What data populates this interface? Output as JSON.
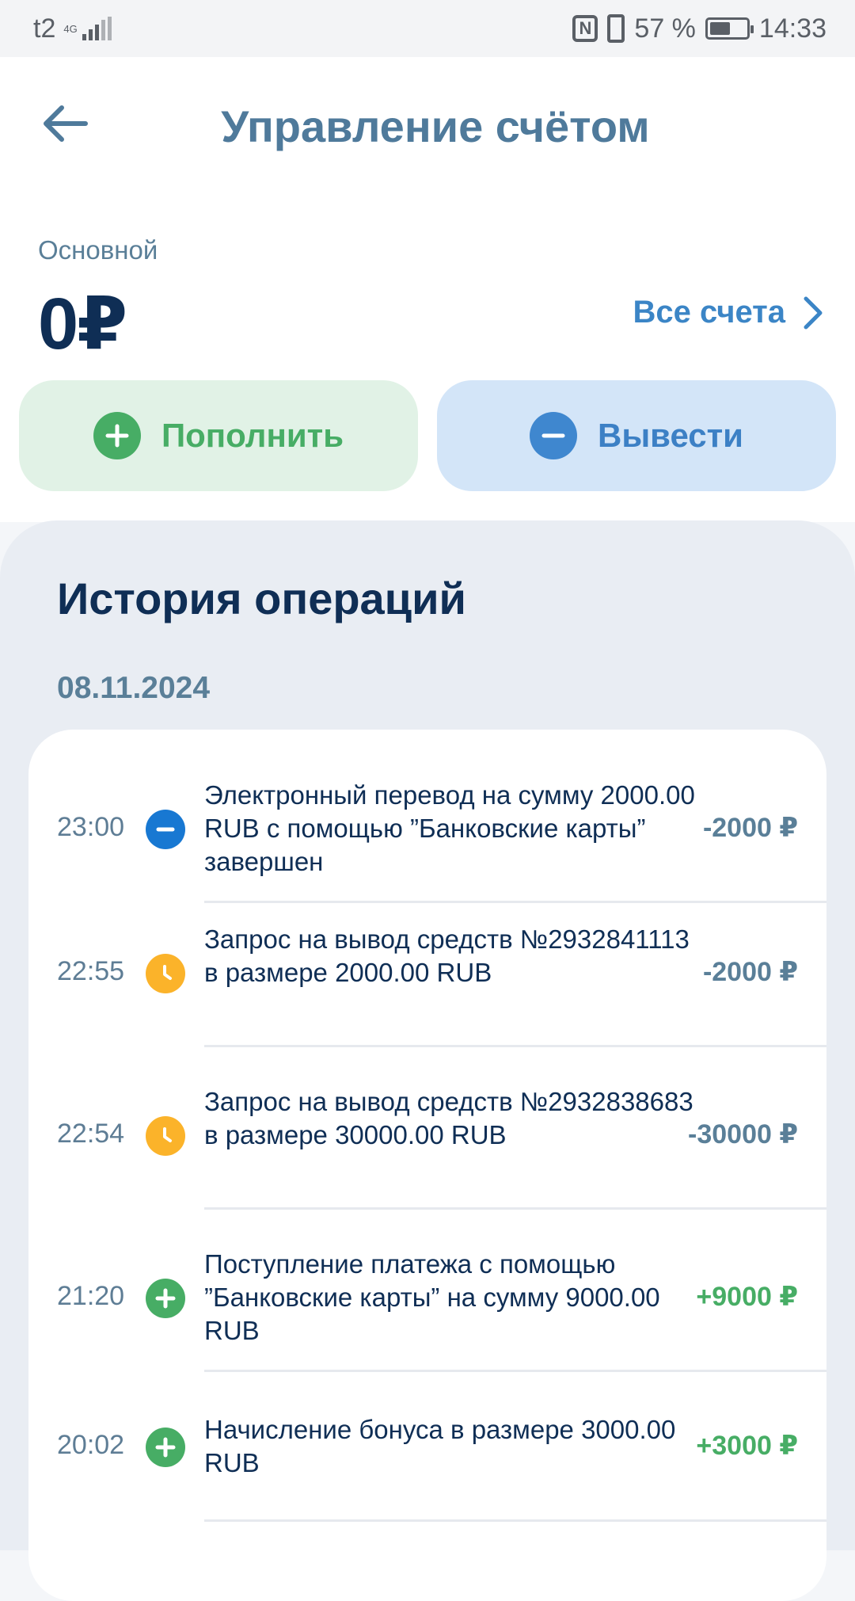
{
  "status_bar": {
    "carrier": "t2",
    "network": "4G",
    "battery_text": "57 %",
    "battery_level": 0.57,
    "time": "14:33"
  },
  "header": {
    "title": "Управление счётом",
    "back_icon": "arrow-left-icon"
  },
  "account": {
    "label": "Основной",
    "balance": "0₽",
    "all_accounts": "Все счета",
    "topup_label": "Пополнить",
    "withdraw_label": "Вывести"
  },
  "history": {
    "title": "История операций",
    "date": "08.11.2024",
    "operations": [
      {
        "time": "23:00",
        "icon": "minus-circle-icon",
        "text": "Электронный перевод на сумму 2000.00 RUB с помощью ”Банковские карты” завершен",
        "amount": "-2000 ₽",
        "sign": "neg"
      },
      {
        "time": "22:55",
        "icon": "clock-icon",
        "text": "Запрос на вывод средств №2932841113 в размере 2000.00 RUB",
        "amount": "-2000 ₽",
        "sign": "neg"
      },
      {
        "time": "22:54",
        "icon": "clock-icon",
        "text": "Запрос на вывод средств №2932838683 в размере 30000.00 RUB",
        "amount": "-30000 ₽",
        "sign": "neg"
      },
      {
        "time": "21:20",
        "icon": "plus-circle-icon",
        "text": "Поступление платежа с помощью ”Банковские карты” на сумму 9000.00 RUB",
        "amount": "+9000 ₽",
        "sign": "pos"
      },
      {
        "time": "20:02",
        "icon": "plus-circle-icon",
        "text": "Начисление бонуса в размере 3000.00 RUB",
        "amount": "+3000 ₽",
        "sign": "pos"
      }
    ]
  },
  "colors": {
    "title_blue": "#4f7a9b",
    "dark_navy": "#0f2e55",
    "green": "#47ad65",
    "blue": "#3c80c5",
    "yellow": "#fbb32a"
  }
}
